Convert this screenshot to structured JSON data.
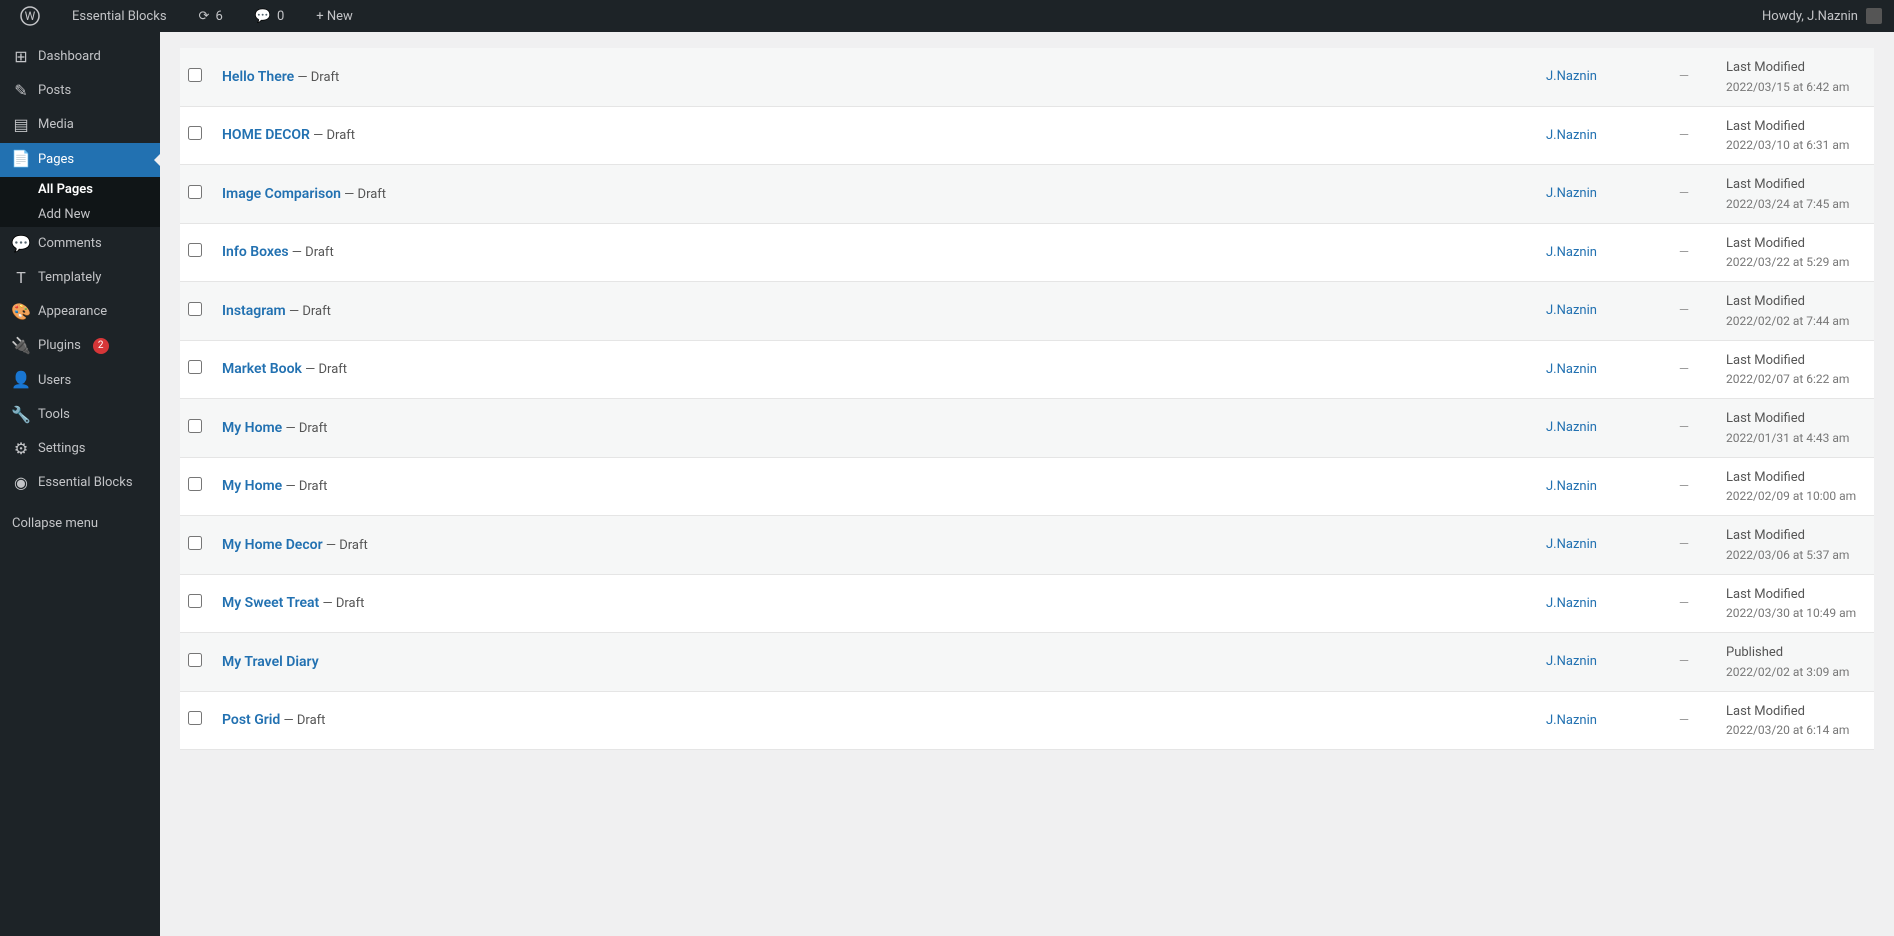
{
  "adminbar": {
    "wp_icon": "⚲",
    "site_name": "Essential Blocks",
    "updates_count": "6",
    "comments_count": "0",
    "new_label": "+ New",
    "howdy": "Howdy, J.Naznin"
  },
  "sidebar": {
    "items": [
      {
        "id": "dashboard",
        "label": "Dashboard",
        "icon": "⊞"
      },
      {
        "id": "posts",
        "label": "Posts",
        "icon": "✎"
      },
      {
        "id": "media",
        "label": "Media",
        "icon": "🖼"
      },
      {
        "id": "pages",
        "label": "Pages",
        "icon": "📄",
        "current": true
      },
      {
        "id": "comments",
        "label": "Comments",
        "icon": "💬"
      },
      {
        "id": "templately",
        "label": "Templately",
        "icon": "T"
      },
      {
        "id": "appearance",
        "label": "Appearance",
        "icon": "🎨"
      },
      {
        "id": "plugins",
        "label": "Plugins",
        "icon": "🔌",
        "badge": "2"
      },
      {
        "id": "users",
        "label": "Users",
        "icon": "👤"
      },
      {
        "id": "tools",
        "label": "Tools",
        "icon": "🔧"
      },
      {
        "id": "settings",
        "label": "Settings",
        "icon": "⚙"
      },
      {
        "id": "essential-blocks",
        "label": "Essential Blocks",
        "icon": "◉"
      }
    ],
    "submenu": {
      "all_pages": "All Pages",
      "add_new": "Add New"
    },
    "collapse": "Collapse menu"
  },
  "pages": [
    {
      "title": "Hello There",
      "status": "Draft",
      "author": "J.Naznin",
      "date_label": "Last Modified",
      "date_value": "2022/03/15 at 6:42 am"
    },
    {
      "title": "HOME DECOR",
      "status": "Draft",
      "author": "J.Naznin",
      "date_label": "Last Modified",
      "date_value": "2022/03/10 at 6:31 am"
    },
    {
      "title": "Image Comparison",
      "status": "Draft",
      "author": "J.Naznin",
      "date_label": "Last Modified",
      "date_value": "2022/03/24 at 7:45 am"
    },
    {
      "title": "Info Boxes",
      "status": "Draft",
      "author": "J.Naznin",
      "date_label": "Last Modified",
      "date_value": "2022/03/22 at 5:29 am"
    },
    {
      "title": "Instagram",
      "status": "Draft",
      "author": "J.Naznin",
      "date_label": "Last Modified",
      "date_value": "2022/02/02 at 7:44 am"
    },
    {
      "title": "Market Book",
      "status": "Draft",
      "author": "J.Naznin",
      "date_label": "Last Modified",
      "date_value": "2022/02/07 at 6:22 am"
    },
    {
      "title": "My Home",
      "status": "Draft",
      "author": "J.Naznin",
      "date_label": "Last Modified",
      "date_value": "2022/01/31 at 4:43 am"
    },
    {
      "title": "My Home",
      "status": "Draft",
      "author": "J.Naznin",
      "date_label": "Last Modified",
      "date_value": "2022/02/09 at 10:00 am"
    },
    {
      "title": "My Home Decor",
      "status": "Draft",
      "author": "J.Naznin",
      "date_label": "Last Modified",
      "date_value": "2022/03/06 at 5:37 am"
    },
    {
      "title": "My Sweet Treat",
      "status": "Draft",
      "author": "J.Naznin",
      "date_label": "Last Modified",
      "date_value": "2022/03/30 at 10:49 am"
    },
    {
      "title": "My Travel Diary",
      "status": "",
      "author": "J.Naznin",
      "date_label": "Published",
      "date_value": "2022/02/02 at 3:09 am"
    },
    {
      "title": "Post Grid",
      "status": "Draft",
      "author": "J.Naznin",
      "date_label": "Last Modified",
      "date_value": "2022/03/20 at 6:14 am"
    }
  ]
}
